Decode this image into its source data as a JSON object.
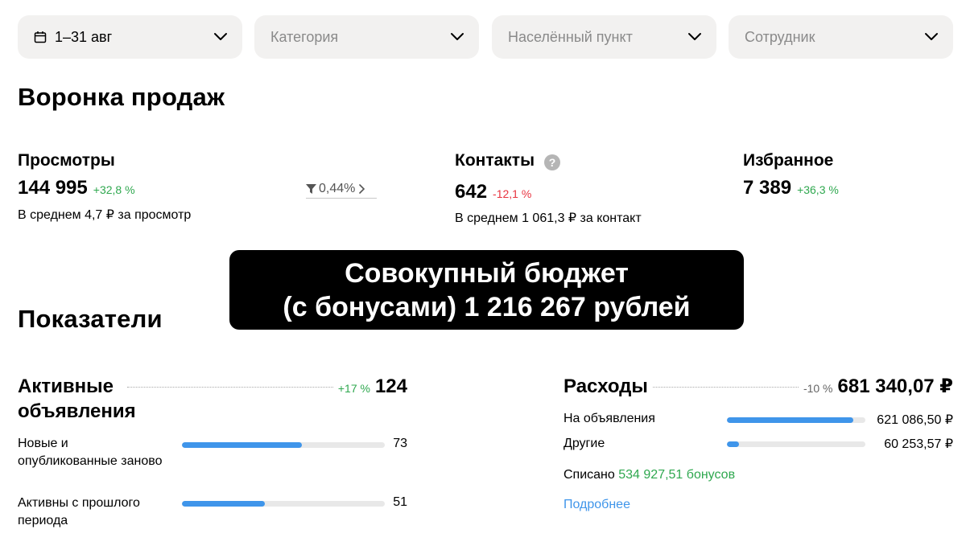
{
  "filters": {
    "period": "1–31 авг",
    "category": "Категория",
    "location": "Населённый пункт",
    "employee": "Сотрудник"
  },
  "funnel": {
    "title": "Воронка продаж",
    "views": {
      "title": "Просмотры",
      "value": "144 995",
      "delta": "+32,8 %",
      "avg": "В среднем 4,7 ₽ за просмотр"
    },
    "conversion": "0,44%",
    "contacts": {
      "title": "Контакты",
      "help": "?",
      "value": "642",
      "delta": "-12,1 %",
      "avg": "В среднем 1 061,3 ₽ за контакт"
    },
    "favorites": {
      "title": "Избранное",
      "value": "7 389",
      "delta": "+36,3 %"
    }
  },
  "overlay": {
    "line1": "Совокупный бюджет",
    "line2": "(с бонусами) 1 216 267 рублей"
  },
  "metrics": {
    "title": "Показатели",
    "active_ads": {
      "title": "Активные объявления",
      "delta": "+17 %",
      "value": "124",
      "rows": [
        {
          "label": "Новые и опубликованные заново",
          "value": "73",
          "fraction": 0.59
        },
        {
          "label": "Активны с прошлого периода",
          "value": "51",
          "fraction": 0.41
        }
      ]
    },
    "expenses": {
      "title": "Расходы",
      "delta": "-10 %",
      "value": "681 340,07 ₽",
      "rows": [
        {
          "label": "На объявления",
          "value": "621 086,50 ₽",
          "fraction": 0.91
        },
        {
          "label": "Другие",
          "value": "60 253,57 ₽",
          "fraction": 0.09
        }
      ],
      "written_off_label": "Списано",
      "written_off_value": "534 927,51 бонусов",
      "more_link": "Подробнее"
    }
  },
  "colors": {
    "positive": "#2fa84f",
    "negative": "#e8333f",
    "accent": "#3f95ea",
    "filter_bg": "#f2f1f0"
  }
}
